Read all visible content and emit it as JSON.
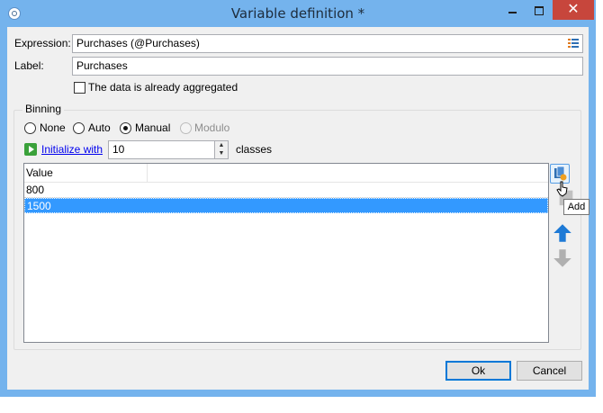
{
  "window": {
    "title": "Variable definition *"
  },
  "form": {
    "expression_label": "Expression:",
    "expression_value": "Purchases (@Purchases)",
    "label_label": "Label:",
    "label_value": "Purchases",
    "aggregated_label": "The data is already aggregated",
    "aggregated_checked": false
  },
  "binning": {
    "title": "Binning",
    "options": [
      "None",
      "Auto",
      "Manual",
      "Modulo"
    ],
    "selected": "Manual",
    "initialize_link": "Initialize with",
    "classes_count": "10",
    "classes_label": "classes"
  },
  "values_list": {
    "column_header": "Value",
    "rows": [
      "800",
      "1500"
    ],
    "selected_row": "1500"
  },
  "side_toolbar": {
    "add_icon": "add-icon",
    "delete_icon": "delete-icon",
    "up_icon": "arrow-up-icon",
    "down_icon": "arrow-down-icon",
    "tooltip": "Add"
  },
  "buttons": {
    "ok": "Ok",
    "cancel": "Cancel"
  },
  "colors": {
    "frame": "#74b3ed",
    "selection": "#3399ff",
    "close": "#c7463c",
    "arrow_active": "#1e7ad6",
    "arrow_disabled": "#b0b0b0"
  }
}
